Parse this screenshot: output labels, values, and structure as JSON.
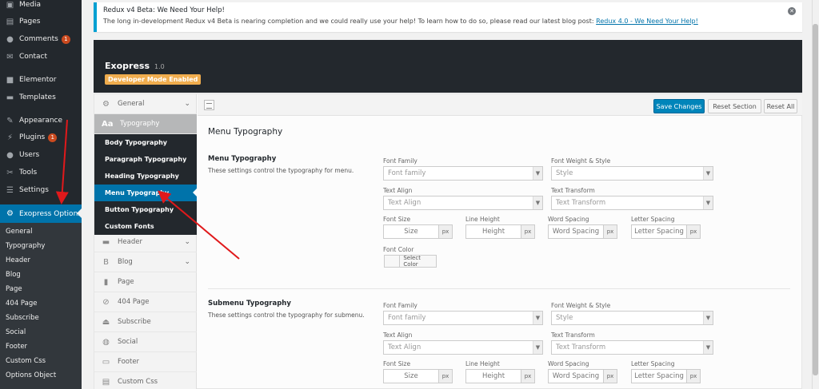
{
  "wp_menu": {
    "items": [
      {
        "label": "Media",
        "icon": "media-icon"
      },
      {
        "label": "Pages",
        "icon": "pages-icon"
      },
      {
        "label": "Comments",
        "icon": "comments-icon",
        "badge": "1"
      },
      {
        "label": "Contact",
        "icon": "mail-icon"
      },
      {
        "label": "Elementor",
        "icon": "elementor-icon"
      },
      {
        "label": "Templates",
        "icon": "folder-icon"
      },
      {
        "label": "Appearance",
        "icon": "paintbrush-icon"
      },
      {
        "label": "Plugins",
        "icon": "plugin-icon",
        "badge": "1"
      },
      {
        "label": "Users",
        "icon": "users-icon"
      },
      {
        "label": "Tools",
        "icon": "wrench-icon"
      },
      {
        "label": "Settings",
        "icon": "settings-icon"
      },
      {
        "label": "Exopress Options",
        "icon": "gear-icon"
      }
    ],
    "submenu": [
      "General",
      "Typography",
      "Header",
      "Blog",
      "Page",
      "404 Page",
      "Subscribe",
      "Social",
      "Footer",
      "Custom Css",
      "Options Object"
    ]
  },
  "notice": {
    "title": "Redux v4 Beta: We Need Your Help!",
    "body": "The long in-development Redux v4 Beta is nearing completion and we could really use your help! To learn how to do so, please read our latest blog post:",
    "link": "Redux 4.0 - We Need Your Help!"
  },
  "header": {
    "app_name": "Exopress",
    "version": "1.0",
    "dev_mode": "Developer Mode Enabled"
  },
  "nav": {
    "general": "General",
    "typography": "Typography",
    "sub": [
      "Body Typography",
      "Paragraph Typography",
      "Heading Typography",
      "Menu Typography",
      "Button Typography",
      "Custom Fonts"
    ],
    "header": "Header",
    "blog": "Blog",
    "page": "Page",
    "page404": "404 Page",
    "subscribe": "Subscribe",
    "social": "Social",
    "footer": "Footer",
    "custom_css": "Custom Css"
  },
  "toolbar": {
    "save": "Save Changes",
    "reset_section": "Reset Section",
    "reset_all": "Reset All"
  },
  "content": {
    "section_title": "Menu Typography",
    "labels": {
      "font_family": "Font Family",
      "font_weight": "Font Weight & Style",
      "text_align": "Text Align",
      "text_transform": "Text Transform",
      "font_size": "Font Size",
      "line_height": "Line Height",
      "word_spacing": "Word Spacing",
      "letter_spacing": "Letter Spacing",
      "font_color": "Font Color"
    },
    "placeholders": {
      "font_family": "Font family",
      "style": "Style",
      "text_align": "Text Align",
      "text_transform": "Text Transform",
      "size": "Size",
      "height": "Height",
      "word_spacing": "Word Spacing",
      "letter_spacing": "Letter Spacing",
      "unit": "px",
      "select_color": "Select Color"
    },
    "menu_group": {
      "title": "Menu Typography",
      "desc": "These settings control the typography for menu."
    },
    "submenu_group": {
      "title": "Submenu Typography",
      "desc": "These settings control the typography for submenu.",
      "font_family_value": "Font family"
    }
  },
  "colors": {
    "wp_sidebar": "#23282d",
    "accent_blue": "#0073aa",
    "save_button": "#0085ba",
    "dev_badge": "#f0ad4e",
    "annotation_red": "#e0191b"
  }
}
